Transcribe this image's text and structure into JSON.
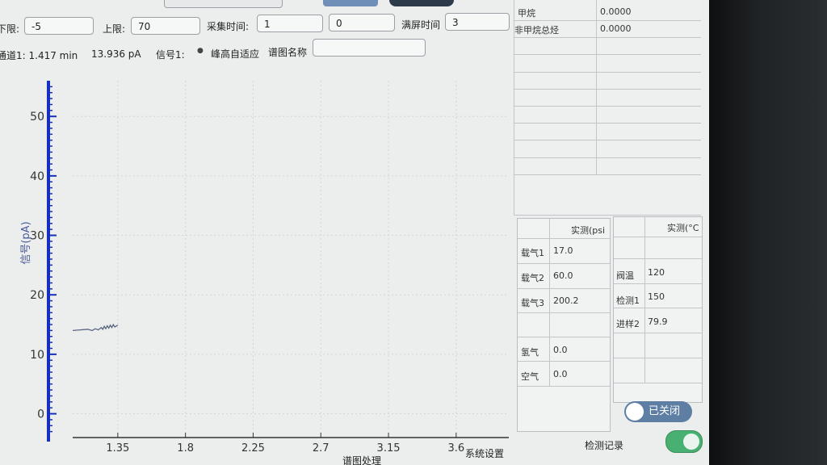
{
  "controls": {
    "lower_label": "下限:",
    "lower_value": "-5",
    "upper_label": "上限:",
    "upper_value": "70",
    "acq_time_label": "采集时间:",
    "acq_time_value": "1",
    "acq_time_value2": "0",
    "fullscreen_label": "满屏时间",
    "fullscreen_value": "3"
  },
  "status": {
    "channel_text": "通道1: 1.417 min",
    "signal_value": "13.936 pA",
    "signal_label": "信号1:",
    "adaptive_label": "峰高自适应",
    "chart_name_label": "谱图名称",
    "chart_name_value": ""
  },
  "chart_data": {
    "type": "line",
    "ylabel": "信号(pA)",
    "xlabel": "",
    "xlim": [
      1.05,
      3.95
    ],
    "ylim": [
      -4,
      56
    ],
    "x_ticks": [
      "1.35",
      "1.8",
      "2.25",
      "2.7",
      "3.15",
      "3.6"
    ],
    "y_ticks": [
      "50",
      "40",
      "30",
      "20",
      "10",
      "0"
    ],
    "grid": true,
    "series": [
      {
        "color": "#5a6680",
        "x": [
          1.05,
          1.1,
          1.15,
          1.18,
          1.2,
          1.22,
          1.24,
          1.25,
          1.26,
          1.27,
          1.28,
          1.29,
          1.3,
          1.31,
          1.32,
          1.33,
          1.35
        ],
        "y": [
          14.0,
          14.1,
          14.2,
          14.0,
          14.3,
          14.1,
          14.5,
          14.2,
          14.7,
          14.3,
          14.8,
          14.4,
          14.9,
          14.5,
          15.0,
          14.6,
          14.9
        ]
      }
    ]
  },
  "results_table": {
    "rows": [
      {
        "name": "甲烷",
        "value": "0.0000"
      },
      {
        "name": "非甲烷总烃",
        "value": "0.0000"
      }
    ]
  },
  "pressure_table": {
    "header": "实测(psi",
    "rows": [
      {
        "name": "载气1",
        "value": "17.0"
      },
      {
        "name": "载气2",
        "value": "60.0"
      },
      {
        "name": "载气3",
        "value": "200.2"
      },
      {
        "name": "",
        "value": ""
      },
      {
        "name": "氢气",
        "value": "0.0"
      },
      {
        "name": "空气",
        "value": "0.0"
      }
    ]
  },
  "temp_table": {
    "header": "实测(°C",
    "rows": [
      {
        "name": "",
        "value": ""
      },
      {
        "name": "阀温",
        "value": "120"
      },
      {
        "name": "检测1",
        "value": "150"
      },
      {
        "name": "进样2",
        "value": "79.9"
      }
    ]
  },
  "bottom": {
    "chart_processing": "谱图处理",
    "system_settings": "系统设置",
    "detection_records": "检测记录",
    "toggle_label": "已关闭"
  }
}
